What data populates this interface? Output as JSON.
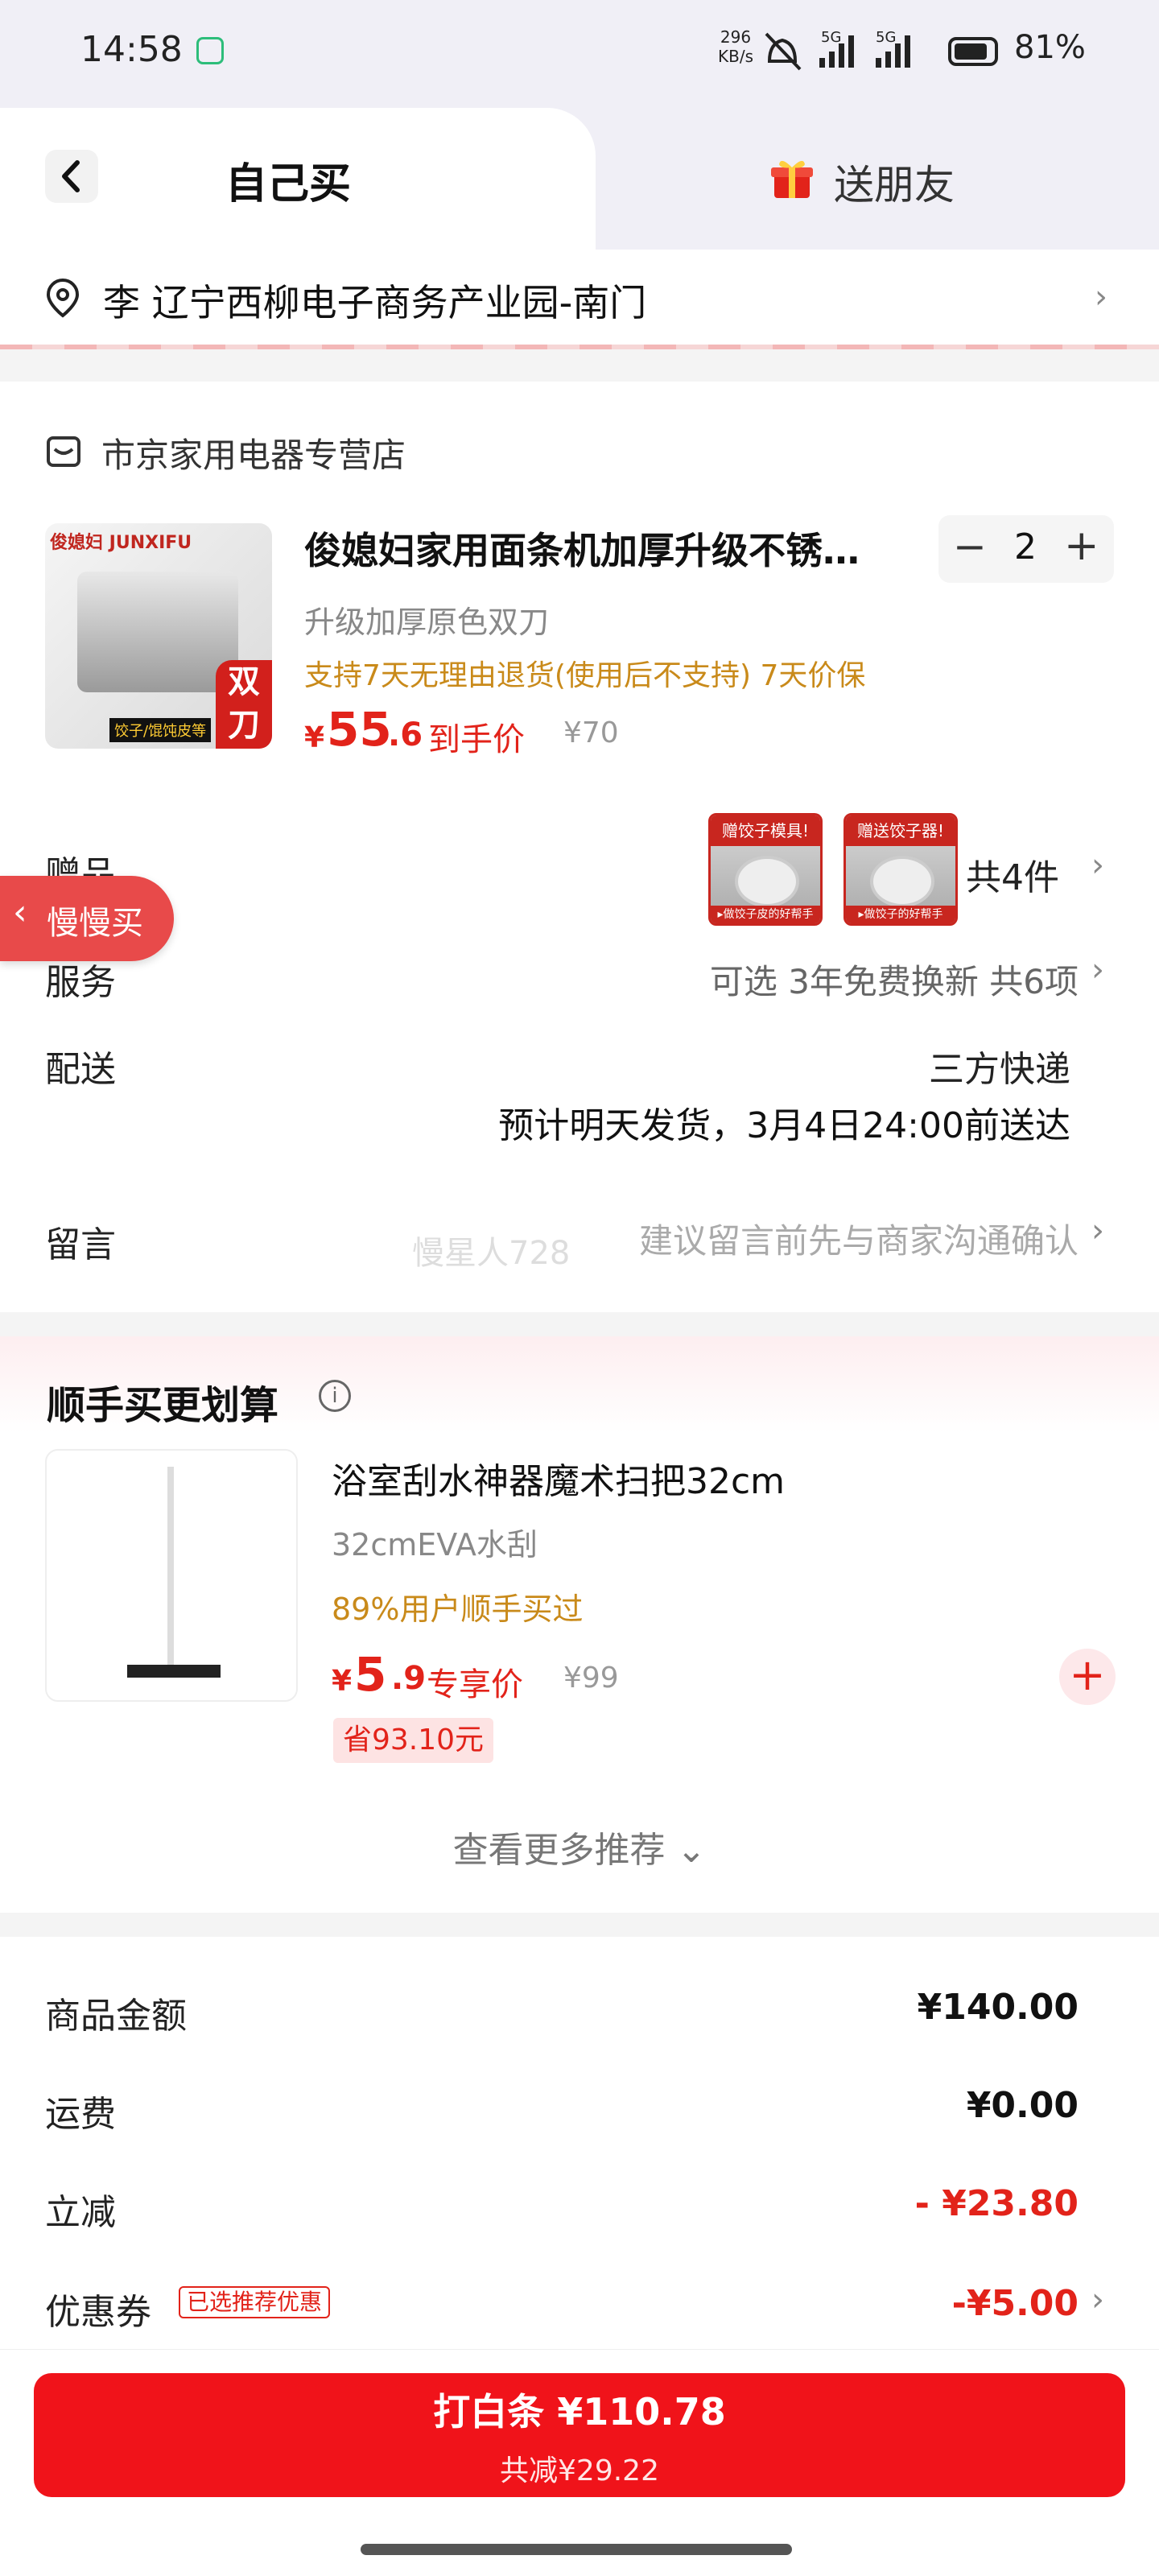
{
  "status_bar": {
    "time": "14:58",
    "net_speed_value": "296",
    "net_speed_unit": "KB/s",
    "net1": "5G",
    "net2": "5G",
    "battery": "81%"
  },
  "tabs": {
    "self": "自己买",
    "gift": "送朋友"
  },
  "address": {
    "text": "李  辽宁西柳电子商务产业园-南门"
  },
  "store": {
    "name": "市京家用电器专营店"
  },
  "product": {
    "image_brand": "俊媳妇 JUNXIFU",
    "image_badge": "双刀",
    "image_tagline": "饺子/馄饨皮等",
    "title": "俊媳妇家用面条机加厚升级不锈…",
    "spec": "升级加厚原色双刀",
    "promise": "支持7天无理由退货(使用后不支持) 7天价保",
    "price_currency": "¥",
    "price_int": "55",
    "price_dec": ".6",
    "price_tag": "到手价",
    "price_original": "¥70",
    "quantity": "2",
    "minus": "−",
    "plus": "+"
  },
  "gifts": {
    "label": "赠品",
    "thumb1_top": "赠饺子模具!",
    "thumb1_bottom": "▸做饺子皮的好帮手",
    "thumb2_top": "赠送饺子器!",
    "thumb2_bottom": "▸做饺子的好帮手",
    "count": "共4件"
  },
  "slow_buy": {
    "label": "慢慢买"
  },
  "service": {
    "label": "服务",
    "value": "可选 3年免费换新 共6项"
  },
  "delivery": {
    "label": "配送",
    "method": "三方快递",
    "eta": "预计明天发货，3月4日24:00前送达"
  },
  "message": {
    "label": "留言",
    "placeholder": "建议留言前先与商家沟通确认",
    "watermark": "慢星人728"
  },
  "recommend": {
    "title": "顺手买更划算",
    "item": {
      "name": "浴室刮水神器魔术扫把32cm",
      "spec": "32cmEVA水刮",
      "buyers": "89%用户顺手买过",
      "price_currency": "¥",
      "price_int": "5",
      "price_dec": ".9",
      "price_tag": "专享价",
      "price_original": "¥99",
      "save": "省93.10元",
      "add": "+"
    },
    "more": "查看更多推荐 ⌄"
  },
  "summary": {
    "goods_label": "商品金额",
    "goods_value": "¥140.00",
    "shipping_label": "运费",
    "shipping_value": "¥0.00",
    "discount_label": "立减",
    "discount_value": "- ¥23.80",
    "coupon_label": "优惠券",
    "coupon_tag": "已选推荐优惠",
    "coupon_value": "-¥5.00"
  },
  "pay": {
    "main": "打白条 ¥110.78",
    "sub": "共减¥29.22"
  },
  "colors": {
    "accent_red": "#e2231a",
    "pay_button": "#f0131a",
    "promise_gold": "#c98a1a",
    "tab_bg": "#f0eff6"
  }
}
